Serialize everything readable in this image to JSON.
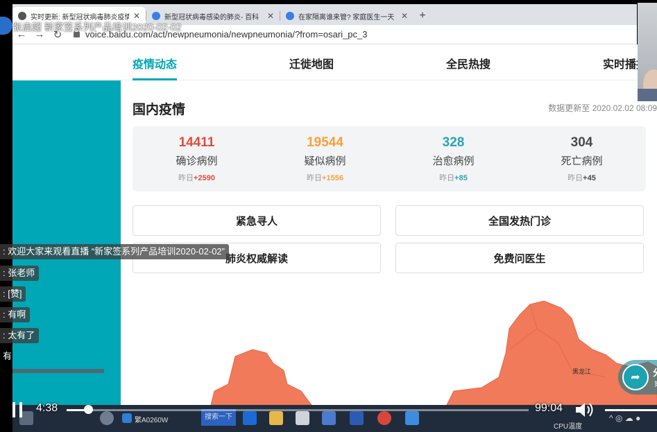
{
  "browser": {
    "tabs": [
      {
        "title": "实时更新: 新型冠状病毒肺炎疫情",
        "active": true
      },
      {
        "title": "新型冠状病毒感染的肺炎- 百科",
        "active": false
      },
      {
        "title": "在家隔离谁来管? 家庭医生一天",
        "active": false
      }
    ],
    "url": "voice.baidu.com/act/newpneumonia/newpneumonia/?from=osari_pc_3",
    "back": "←",
    "forward": "→",
    "reload": "↻",
    "close_glyph": "✕",
    "new_tab": "+"
  },
  "overlay_title": "张启超 新家签系列产品培训2020-02-02",
  "page": {
    "tabs": [
      "疫情动态",
      "迁徙地图",
      "全民热搜",
      "实时播报"
    ],
    "section_title": "国内疫情",
    "updated": "数据更新至 2020.02.02 08:09",
    "yesterday_label": "昨日",
    "stats": [
      {
        "value": "14411",
        "label": "确诊病例",
        "delta": "+2590",
        "color": "#e64a3b"
      },
      {
        "value": "19544",
        "label": "疑似病例",
        "delta": "+1556",
        "color": "#f7a13a"
      },
      {
        "value": "328",
        "label": "治愈病例",
        "delta": "+85",
        "color": "#2aa4b7"
      },
      {
        "value": "304",
        "label": "死亡病例",
        "delta": "+45",
        "color": "#4a4a4a"
      }
    ],
    "buttons": [
      "紧急寻人",
      "全国发热门诊",
      "肺炎权威解读",
      "免费问医生"
    ],
    "map_label": "黑龙江",
    "share": {
      "label": "分",
      "sub": "第"
    }
  },
  "chat": [
    {
      "text": ": 欢迎大家来观看直播 “新家签系列产品培训2020-02-02”"
    },
    {
      "text": ": 张老师"
    },
    {
      "text": ": [赞]"
    },
    {
      "text": ": 有啊"
    },
    {
      "text": ": 太有了"
    },
    {
      "text": "有"
    }
  ],
  "player": {
    "current": "4:38",
    "duration": "99:04",
    "progress": 0.047
  },
  "taskbar": {
    "ime": "繁A0260W",
    "search": "搜索一下",
    "temp_top": "",
    "temp_bottom": "CPU温度"
  }
}
